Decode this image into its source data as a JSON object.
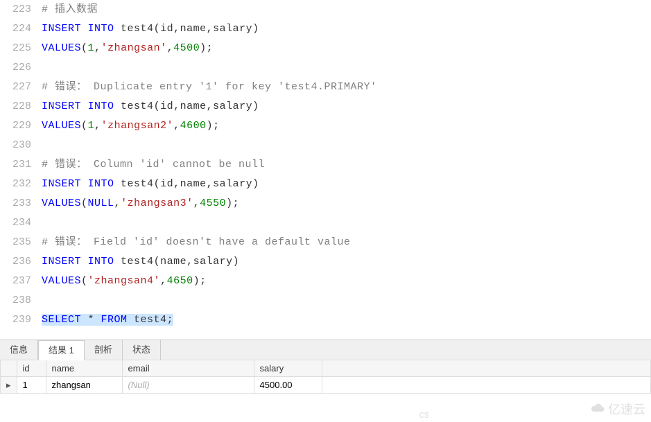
{
  "editor": {
    "startLine": 223,
    "lines": [
      {
        "n": 223,
        "seg": [
          {
            "t": "# 插入数据",
            "c": "cmt"
          }
        ]
      },
      {
        "n": 224,
        "seg": [
          {
            "t": "INSERT",
            "c": "kw"
          },
          {
            "t": " ",
            "c": "ident"
          },
          {
            "t": "INTO",
            "c": "kw"
          },
          {
            "t": " test4",
            "c": "ident"
          },
          {
            "t": "(",
            "c": "punct"
          },
          {
            "t": "id",
            "c": "ident"
          },
          {
            "t": ",",
            "c": "punct"
          },
          {
            "t": "name",
            "c": "ident"
          },
          {
            "t": ",",
            "c": "punct"
          },
          {
            "t": "salary",
            "c": "ident"
          },
          {
            "t": ")",
            "c": "punct"
          }
        ]
      },
      {
        "n": 225,
        "seg": [
          {
            "t": "VALUES",
            "c": "kw"
          },
          {
            "t": "(",
            "c": "punct"
          },
          {
            "t": "1",
            "c": "num"
          },
          {
            "t": ",",
            "c": "punct"
          },
          {
            "t": "'zhangsan'",
            "c": "str"
          },
          {
            "t": ",",
            "c": "punct"
          },
          {
            "t": "4500",
            "c": "num"
          },
          {
            "t": ");",
            "c": "punct"
          }
        ]
      },
      {
        "n": 226,
        "seg": []
      },
      {
        "n": 227,
        "seg": [
          {
            "t": "# 错误： Duplicate entry '1' for key 'test4.PRIMARY'",
            "c": "cmt"
          }
        ]
      },
      {
        "n": 228,
        "seg": [
          {
            "t": "INSERT",
            "c": "kw"
          },
          {
            "t": " ",
            "c": "ident"
          },
          {
            "t": "INTO",
            "c": "kw"
          },
          {
            "t": " test4",
            "c": "ident"
          },
          {
            "t": "(",
            "c": "punct"
          },
          {
            "t": "id",
            "c": "ident"
          },
          {
            "t": ",",
            "c": "punct"
          },
          {
            "t": "name",
            "c": "ident"
          },
          {
            "t": ",",
            "c": "punct"
          },
          {
            "t": "salary",
            "c": "ident"
          },
          {
            "t": ")",
            "c": "punct"
          }
        ]
      },
      {
        "n": 229,
        "seg": [
          {
            "t": "VALUES",
            "c": "kw"
          },
          {
            "t": "(",
            "c": "punct"
          },
          {
            "t": "1",
            "c": "num"
          },
          {
            "t": ",",
            "c": "punct"
          },
          {
            "t": "'zhangsan2'",
            "c": "str"
          },
          {
            "t": ",",
            "c": "punct"
          },
          {
            "t": "4600",
            "c": "num"
          },
          {
            "t": ");",
            "c": "punct"
          }
        ]
      },
      {
        "n": 230,
        "seg": []
      },
      {
        "n": 231,
        "seg": [
          {
            "t": "# 错误： Column 'id' cannot be null",
            "c": "cmt"
          }
        ]
      },
      {
        "n": 232,
        "seg": [
          {
            "t": "INSERT",
            "c": "kw"
          },
          {
            "t": " ",
            "c": "ident"
          },
          {
            "t": "INTO",
            "c": "kw"
          },
          {
            "t": " test4",
            "c": "ident"
          },
          {
            "t": "(",
            "c": "punct"
          },
          {
            "t": "id",
            "c": "ident"
          },
          {
            "t": ",",
            "c": "punct"
          },
          {
            "t": "name",
            "c": "ident"
          },
          {
            "t": ",",
            "c": "punct"
          },
          {
            "t": "salary",
            "c": "ident"
          },
          {
            "t": ")",
            "c": "punct"
          }
        ]
      },
      {
        "n": 233,
        "seg": [
          {
            "t": "VALUES",
            "c": "kw"
          },
          {
            "t": "(",
            "c": "punct"
          },
          {
            "t": "NULL",
            "c": "kw"
          },
          {
            "t": ",",
            "c": "punct"
          },
          {
            "t": "'zhangsan3'",
            "c": "str"
          },
          {
            "t": ",",
            "c": "punct"
          },
          {
            "t": "4550",
            "c": "num"
          },
          {
            "t": ");",
            "c": "punct"
          }
        ]
      },
      {
        "n": 234,
        "seg": []
      },
      {
        "n": 235,
        "seg": [
          {
            "t": "# 错误： Field 'id' doesn't have a default value",
            "c": "cmt"
          }
        ]
      },
      {
        "n": 236,
        "seg": [
          {
            "t": "INSERT",
            "c": "kw"
          },
          {
            "t": " ",
            "c": "ident"
          },
          {
            "t": "INTO",
            "c": "kw"
          },
          {
            "t": " test4",
            "c": "ident"
          },
          {
            "t": "(",
            "c": "punct"
          },
          {
            "t": "name",
            "c": "ident"
          },
          {
            "t": ",",
            "c": "punct"
          },
          {
            "t": "salary",
            "c": "ident"
          },
          {
            "t": ")",
            "c": "punct"
          }
        ]
      },
      {
        "n": 237,
        "seg": [
          {
            "t": "VALUES",
            "c": "kw"
          },
          {
            "t": "(",
            "c": "punct"
          },
          {
            "t": "'zhangsan4'",
            "c": "str"
          },
          {
            "t": ",",
            "c": "punct"
          },
          {
            "t": "4650",
            "c": "num"
          },
          {
            "t": ");",
            "c": "punct"
          }
        ]
      },
      {
        "n": 238,
        "seg": []
      },
      {
        "n": 239,
        "hl": true,
        "seg": [
          {
            "t": "SELECT",
            "c": "kw"
          },
          {
            "t": " * ",
            "c": "ident"
          },
          {
            "t": "FROM",
            "c": "kw"
          },
          {
            "t": " test4",
            "c": "ident"
          },
          {
            "t": ";",
            "c": "punct"
          }
        ]
      }
    ]
  },
  "panel": {
    "tabs": [
      "信息",
      "结果 1",
      "剖析",
      "状态"
    ],
    "activeTab": 1,
    "columns": [
      "id",
      "name",
      "email",
      "salary"
    ],
    "rows": [
      {
        "id": "1",
        "name": "zhangsan",
        "email": "(Null)",
        "email_null": true,
        "salary": "4500.00"
      }
    ]
  },
  "watermark": "亿速云",
  "csmark": "CS"
}
